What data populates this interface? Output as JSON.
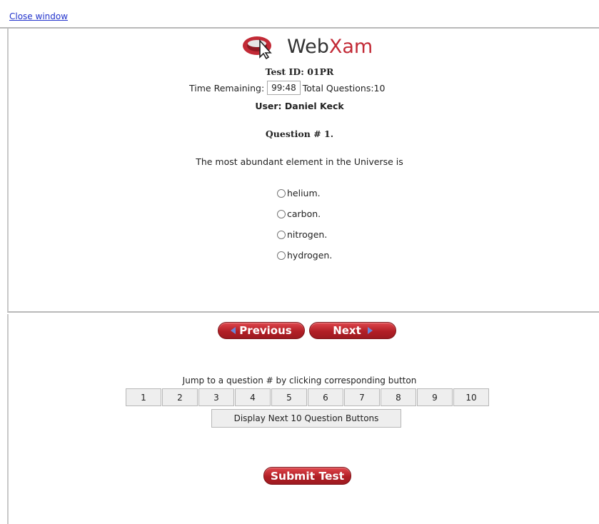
{
  "header": {
    "close_link": "Close window"
  },
  "logo": {
    "text_web": "Web",
    "text_xam": "Xam",
    "icon": "webxam-cursor-logo-icon"
  },
  "exam": {
    "test_id": "Test ID: 01PR",
    "time_label": "Time Remaining:",
    "time_value": "99:48",
    "total_questions": "Total Questions:10",
    "user": "User: Daniel Keck"
  },
  "question": {
    "number_label": "Question # 1.",
    "text": "The most abundant element in the Universe is",
    "options": [
      "helium.",
      "carbon.",
      "nitrogen.",
      "hydrogen."
    ]
  },
  "navigation": {
    "previous_label": "Previous",
    "next_label": "Next",
    "jump_instruction": "Jump to a question # by clicking corresponding button",
    "question_buttons": [
      "1",
      "2",
      "3",
      "4",
      "5",
      "6",
      "7",
      "8",
      "9",
      "10"
    ],
    "display_next_label": "Display Next 10 Question Buttons",
    "submit_label": "Submit Test"
  },
  "colors": {
    "brand_red": "#c22a36",
    "link_blue": "#2233cc",
    "arrow_blue": "#6a84d8"
  }
}
